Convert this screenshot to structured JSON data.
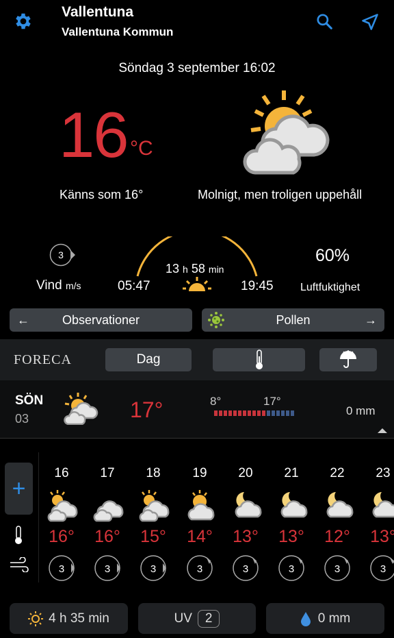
{
  "header": {
    "location": "Vallentuna",
    "municipality": "Vallentuna Kommun",
    "icons": [
      "gear-icon",
      "search-icon",
      "location-arrow-icon"
    ],
    "accent": "#2f8de4"
  },
  "datetime": "Söndag 3 september 16:02",
  "current": {
    "temp": "16",
    "unit": "°C",
    "feels_like": "Känns som 16°",
    "condition": "Molnigt, men troligen uppehåll",
    "icon": "sun-behind-clouds-icon",
    "temp_color": "#d9343a"
  },
  "details": {
    "wind_value": "3",
    "wind_label": "Vind",
    "wind_unit": "m/s",
    "daylength_h": "13",
    "daylength_h_unit": "h",
    "daylength_m": "58",
    "daylength_m_unit": "min",
    "sunrise": "05:47",
    "sunset": "19:45",
    "humidity": "60%",
    "humidity_label": "Luftfuktighet"
  },
  "buttons": {
    "observations": "Observationer",
    "pollen": "Pollen",
    "arrow_left": "←",
    "arrow_right": "→"
  },
  "brand": "FORECA",
  "tabs": {
    "day": "Dag"
  },
  "today": {
    "day": "SÖN",
    "date": "03",
    "temp": "17°",
    "min": "8°",
    "max": "17°",
    "precip": "0 mm"
  },
  "hourly": [
    {
      "hour": "16",
      "icon": "partly-cloudy-day-icon",
      "temp": "16°",
      "wind": "3"
    },
    {
      "hour": "17",
      "icon": "cloudy-icon",
      "temp": "16°",
      "wind": "3"
    },
    {
      "hour": "18",
      "icon": "partly-cloudy-day-icon",
      "temp": "15°",
      "wind": "3"
    },
    {
      "hour": "19",
      "icon": "sun-behind-cloud-icon",
      "temp": "14°",
      "wind": "3"
    },
    {
      "hour": "20",
      "icon": "moon-cloud-icon",
      "temp": "13°",
      "wind": "3"
    },
    {
      "hour": "21",
      "icon": "moon-cloud-icon",
      "temp": "13°",
      "wind": "3"
    },
    {
      "hour": "22",
      "icon": "moon-cloud-icon",
      "temp": "12°",
      "wind": "3"
    },
    {
      "hour": "23",
      "icon": "moon-cloud-icon",
      "temp": "13°",
      "wind": "3"
    }
  ],
  "add_label": "+",
  "bottom": {
    "sunshine": "4 h 35 min",
    "uv_label": "UV",
    "uv_value": "2",
    "precip": "0 mm"
  }
}
